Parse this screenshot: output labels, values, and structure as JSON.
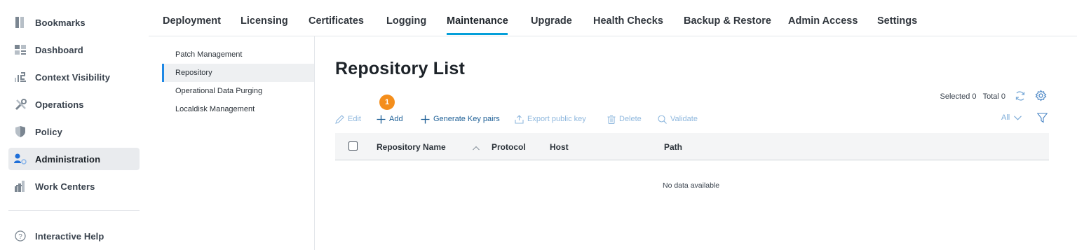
{
  "left_nav": {
    "items": [
      {
        "label": "Bookmarks",
        "icon": "bookmark-icon"
      },
      {
        "label": "Dashboard",
        "icon": "dashboard-icon"
      },
      {
        "label": "Context Visibility",
        "icon": "context-visibility-icon"
      },
      {
        "label": "Operations",
        "icon": "operations-icon"
      },
      {
        "label": "Policy",
        "icon": "policy-icon"
      },
      {
        "label": "Administration",
        "icon": "administration-icon",
        "active": true
      },
      {
        "label": "Work Centers",
        "icon": "work-centers-icon"
      }
    ],
    "help": {
      "label": "Interactive Help",
      "icon": "help-icon"
    }
  },
  "tabs": [
    {
      "label": "Deployment"
    },
    {
      "label": "Licensing"
    },
    {
      "label": "Certificates"
    },
    {
      "label": "Logging"
    },
    {
      "label": "Maintenance",
      "active": true
    },
    {
      "label": "Upgrade"
    },
    {
      "label": "Health Checks"
    },
    {
      "label": "Backup & Restore"
    },
    {
      "label": "Admin Access"
    },
    {
      "label": "Settings"
    }
  ],
  "subnav": [
    {
      "label": "Patch Management"
    },
    {
      "label": "Repository",
      "active": true
    },
    {
      "label": "Operational Data Purging"
    },
    {
      "label": "Localdisk Management"
    }
  ],
  "main": {
    "title": "Repository List",
    "step_badge": "1",
    "summary": {
      "selected": "Selected 0",
      "total": "Total 0"
    },
    "toolbar": {
      "edit": "Edit",
      "add": "Add",
      "generate_key_pairs": "Generate Key pairs",
      "export_public_key": "Export public key",
      "delete": "Delete",
      "validate": "Validate"
    },
    "filter": {
      "selected": "All"
    },
    "table": {
      "columns": [
        "Repository Name",
        "Protocol",
        "Host",
        "Path"
      ],
      "empty_text": "No data available"
    }
  },
  "colors": {
    "accent": "#049fd9",
    "active_nav_bg": "#e9ebee",
    "badge": "#f48e1c",
    "link_enabled": "#1d5f96",
    "link_disabled": "#8fb8de"
  }
}
